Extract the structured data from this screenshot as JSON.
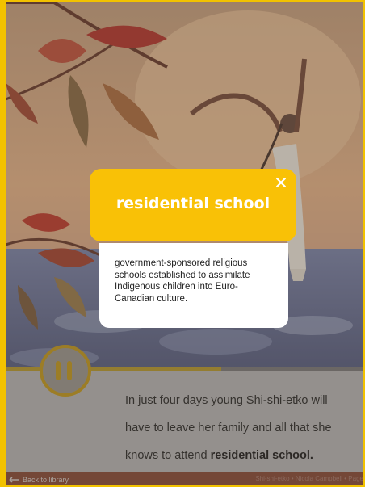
{
  "reader": {
    "progress": 0.6,
    "story_line_1": "In just four days young Shi-shi-etko will",
    "story_line_2": "have to leave her family and all that she",
    "story_line_3_prefix": "knows to attend ",
    "story_line_3_bold": "residential school."
  },
  "popup": {
    "term": "residential school",
    "definition": "government-sponsored religious schools established to assimilate Indigenous children into Euro-Canadian culture.",
    "close_icon": "close-icon"
  },
  "footer": {
    "back_label": "Back to library",
    "credit": "Shi-shi-etko • Nicola Campbell • Page"
  },
  "colors": {
    "accent": "#f9c106",
    "frame": "#f2c200",
    "footer": "#8a4a36"
  }
}
